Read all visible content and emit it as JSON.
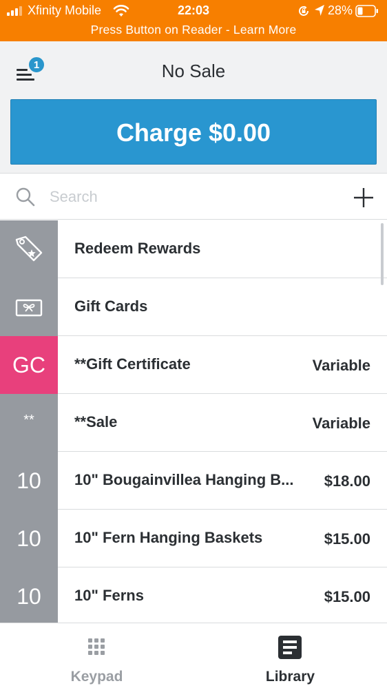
{
  "status_bar": {
    "carrier": "Xfinity Mobile",
    "time": "22:03",
    "battery": "28%",
    "icons": [
      "signal-icon",
      "wifi-icon",
      "rotation-lock-icon",
      "location-arrow-icon",
      "battery-icon"
    ]
  },
  "banner": {
    "text": "Press Button on Reader - Learn More"
  },
  "header": {
    "title": "No Sale",
    "menu_badge": "1",
    "charge_label": "Charge $0.00"
  },
  "search": {
    "placeholder": "Search"
  },
  "items": [
    {
      "tile": "",
      "tile_icon": "tag-star-icon",
      "label": "Redeem Rewards",
      "price": ""
    },
    {
      "tile": "",
      "tile_icon": "gift-card-icon",
      "label": "Gift Cards",
      "price": ""
    },
    {
      "tile": "GC",
      "tile_icon": "",
      "label": "**Gift Certificate",
      "price": "Variable",
      "tile_color": "#e8407c"
    },
    {
      "tile": "**",
      "tile_icon": "",
      "label": "**Sale",
      "price": "Variable"
    },
    {
      "tile": "10",
      "tile_icon": "",
      "label": "10\" Bougainvillea Hanging B...",
      "price": "$18.00"
    },
    {
      "tile": "10",
      "tile_icon": "",
      "label": "10\" Fern Hanging Baskets",
      "price": "$15.00"
    },
    {
      "tile": "10",
      "tile_icon": "",
      "label": "10\" Ferns",
      "price": "$15.00"
    }
  ],
  "tabs": [
    {
      "label": "Keypad",
      "icon": "keypad-icon",
      "active": false
    },
    {
      "label": "Library",
      "icon": "library-icon",
      "active": true
    }
  ],
  "colors": {
    "status_bar": "#f77f00",
    "charge_button": "#2996d0",
    "badge": "#2996cc",
    "tile_gray": "#969aa0",
    "tile_pink": "#e8407c",
    "tab_inactive": "#9a9ea3",
    "tab_active": "#2b2f33"
  }
}
